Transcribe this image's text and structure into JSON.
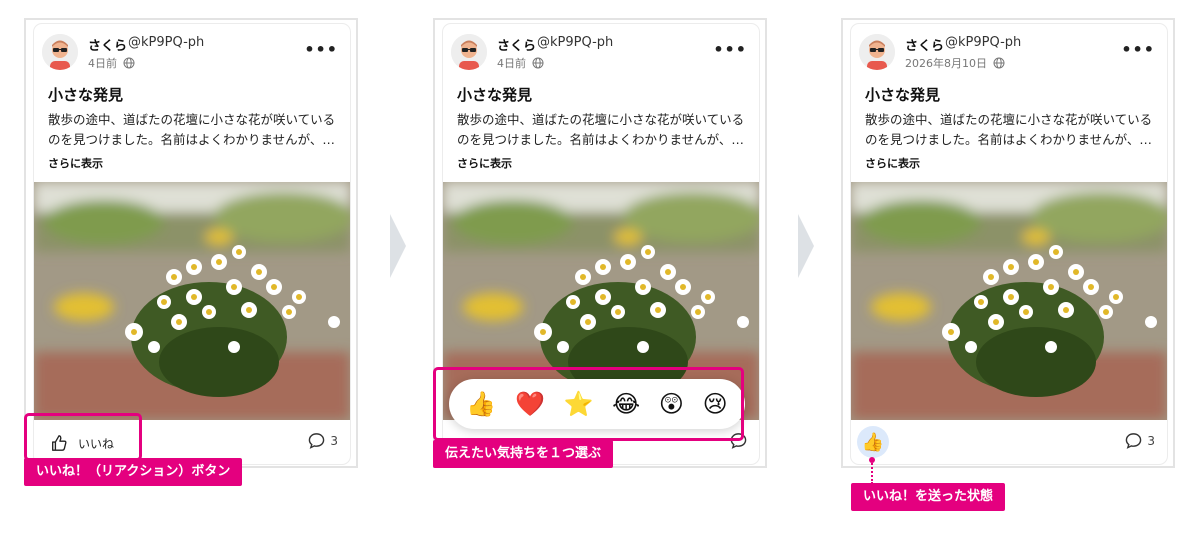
{
  "post": {
    "name": "さくら",
    "handle": "@kP9PQ-ph",
    "title": "小さな発見",
    "body": "散歩の途中、道ばたの花壇に小さな花が咲いているのを見つけました。名前はよくわかりませんが、…",
    "see_more": "さらに表示",
    "like_label": "いいね",
    "comment_count": "3",
    "menu": "•••"
  },
  "panels": [
    {
      "time": "4日前"
    },
    {
      "time": "4日前"
    },
    {
      "time": "2026年8月10日"
    }
  ],
  "callouts": {
    "like_button": "いいね！（リアクション）ボタン",
    "choose_reaction": "伝えたい気持ちを１つ選ぶ",
    "liked_state": "いいね！を送った状態"
  },
  "reactions": [
    "👍",
    "❤️",
    "⭐",
    "😂",
    "😲",
    "😢"
  ],
  "liked_reaction": "👍",
  "colors": {
    "accent": "#e4007f",
    "liked_bg": "#dce9fb"
  },
  "icons": [
    "avatar",
    "globe-icon",
    "more-icon",
    "thumbs-up-icon",
    "comment-icon",
    "chevron-right-icon"
  ]
}
